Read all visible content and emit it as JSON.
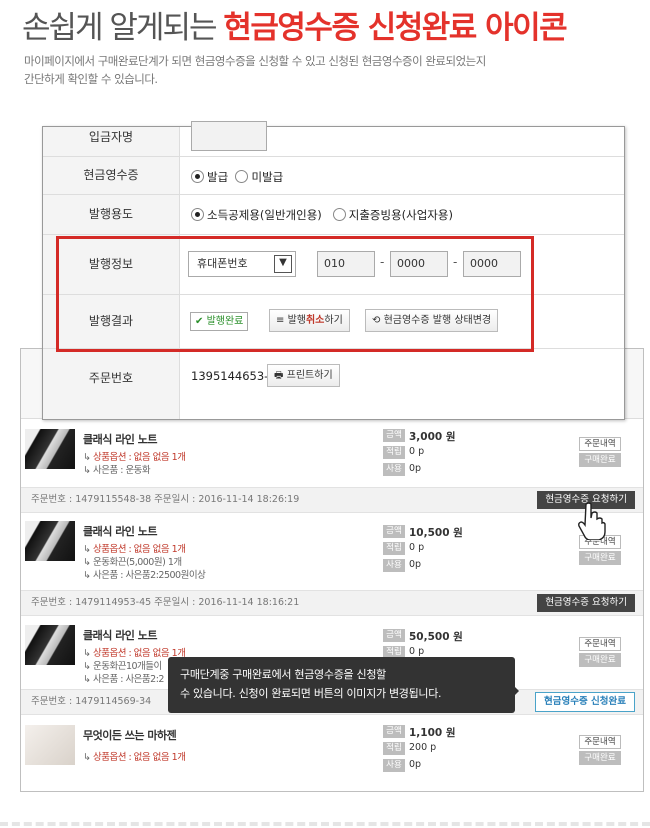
{
  "headline": {
    "light": "손쉽게 알게되는 ",
    "bold": "현금영수증 신청완료 아이콘"
  },
  "description": [
    "마이페이지에서 구매완료단계가 되면 현금영수증을 신청할 수 있고 신청된 현금영수증이 완료되었는지",
    "간단하게 확인할 수 있습니다."
  ],
  "form": {
    "depositor_label": "입금자명",
    "receipt_label": "현금영수증",
    "receipt_options": [
      "발급",
      "미발급"
    ],
    "usage_label": "발행용도",
    "usage_options": [
      "소득공제용(일반개인용)",
      "지출증빙용(사업자용)"
    ],
    "info_label": "발행정보",
    "phone_type": "휴대폰번호",
    "phone": [
      "010",
      "0000",
      "0000"
    ],
    "result_label": "발행결과",
    "result_done": "발행완료",
    "cancel_prefix": "발행",
    "cancel_red": "취소",
    "cancel_suffix": "하기",
    "change_status": "현금영수증 발행 상태변경",
    "order_label": "주문번호",
    "order_number": "1395144653-9",
    "print_button": "프린트하기"
  },
  "orders": [
    {
      "name": "클래식 라인 노트",
      "lines": [
        "상품옵션 : 없음 없음 1개",
        "사은품 : 운동화"
      ],
      "amount": "3,000 원",
      "points": "0 p",
      "used": "0p",
      "meta": "주문번호 : 1479115548-38    주문일시 : 2016-11-14 18:26:19",
      "action": "현금영수증 요청하기"
    },
    {
      "name": "클래식 라인 노트",
      "lines": [
        "상품옵션 : 없음 없음 1개",
        "운동화끈(5,000원) 1개",
        "사은품 : 사은품2:2500원이상"
      ],
      "amount": "10,500 원",
      "points": "0 p",
      "used": "0p",
      "meta": "주문번호 : 1479114953-45    주문일시 : 2016-11-14 18:16:21",
      "action": "현금영수증 요청하기"
    },
    {
      "name": "클래식 라인 노트",
      "lines": [
        "상품옵션 : 없음 없음 1개",
        "운동화끈10개들이",
        "사은품 : 사은품2:2"
      ],
      "amount": "50,500 원",
      "points": "0 p",
      "used": "0p",
      "meta": "주문번호 : 1479114569-34",
      "action": "현금영수증 신청완료"
    },
    {
      "name": "무엇이든 쓰는 마하젠",
      "lines": [
        "상품옵션 : 없음 없음 1개"
      ],
      "amount": "1,100 원",
      "points": "200 p",
      "used": "0p"
    }
  ],
  "tags": {
    "amount": "금액",
    "points": "적립",
    "used": "사용"
  },
  "side": {
    "detail": "주문내역",
    "done": "구매완료"
  },
  "tooltip": [
    "구매단계중 구매완료에서 현금영수증을 신청할",
    "수 있습니다. 신청이 완료되면 버튼의 이미지가 변경됩니다."
  ]
}
